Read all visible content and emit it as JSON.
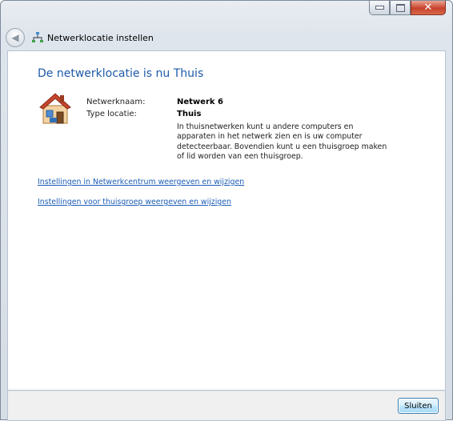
{
  "window": {
    "title": "Netwerklocatie instellen",
    "caption": {
      "minimize": "–",
      "maximize": "□",
      "close": "✕"
    }
  },
  "main": {
    "heading": "De netwerklocatie is nu Thuis",
    "network_name_label": "Netwerknaam:",
    "network_name_value": "Netwerk 6",
    "location_type_label": "Type locatie:",
    "location_type_value": "Thuis",
    "description": "In thuisnetwerken kunt u andere computers en apparaten in het netwerk zien en is uw computer detecteerbaar. Bovendien kunt u een thuisgroep maken of lid worden van een thuisgroep.",
    "links": [
      "Instellingen in Netwerkcentrum weergeven en wijzigen",
      "Instellingen voor thuisgroep weergeven en wijzigen"
    ]
  },
  "footer": {
    "close_button": "Sluiten"
  },
  "icons": {
    "back": "back-arrow-icon",
    "network": "network-icon",
    "house": "home-network-icon"
  },
  "colors": {
    "heading": "#1e5aa8",
    "link": "#1c5db5",
    "close_button_border": "#3c7fb1"
  }
}
